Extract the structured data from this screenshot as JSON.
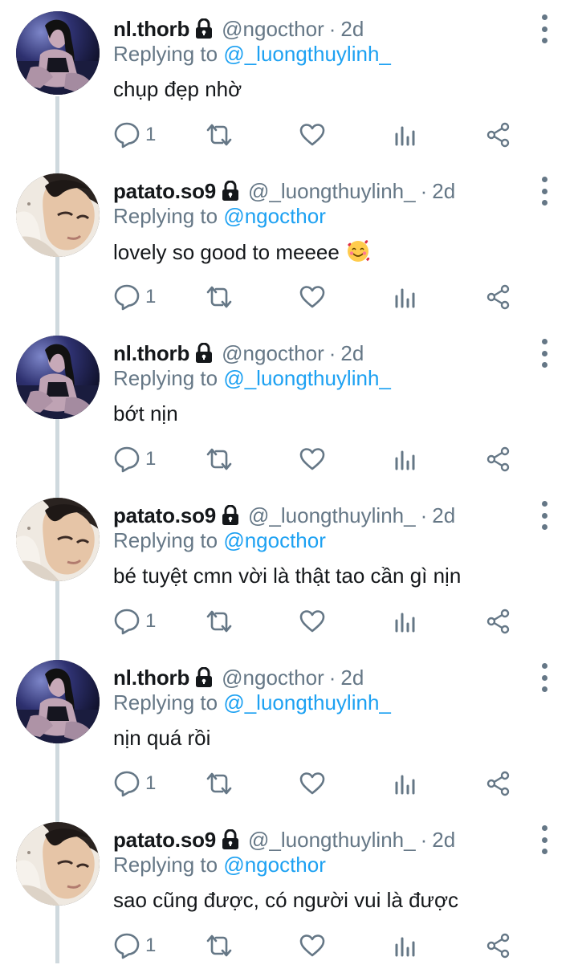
{
  "colors": {
    "text": "#14171a",
    "secondary": "#657786",
    "mention": "#1da1f2",
    "thread_line": "#cfd9de"
  },
  "tweets": [
    {
      "name": "nl.thorb",
      "handle": "@ngocthor",
      "separator": "·",
      "time": "2d",
      "replying_prefix": "Replying to",
      "replying_to": "@_luongthuylinh_",
      "text": "chụp đẹp nhờ",
      "reply_count": "1",
      "avatar": "avatar-ngocthor"
    },
    {
      "name": "patato.so9",
      "handle": "@_luongthuylinh_",
      "separator": "·",
      "time": "2d",
      "replying_prefix": "Replying to",
      "replying_to": "@ngocthor",
      "text": "lovely so good to meeee",
      "emoji": "smiling-face-with-hearts-emoji",
      "reply_count": "1",
      "avatar": "avatar-luongthuylinh"
    },
    {
      "name": "nl.thorb",
      "handle": "@ngocthor",
      "separator": "·",
      "time": "2d",
      "replying_prefix": "Replying to",
      "replying_to": "@_luongthuylinh_",
      "text": "bớt nịn",
      "reply_count": "1",
      "avatar": "avatar-ngocthor"
    },
    {
      "name": "patato.so9",
      "handle": "@_luongthuylinh_",
      "separator": "·",
      "time": "2d",
      "replying_prefix": "Replying to",
      "replying_to": "@ngocthor",
      "text": "bé tuyệt cmn vời là thật tao cần gì nịn",
      "reply_count": "1",
      "avatar": "avatar-luongthuylinh"
    },
    {
      "name": "nl.thorb",
      "handle": "@ngocthor",
      "separator": "·",
      "time": "2d",
      "replying_prefix": "Replying to",
      "replying_to": "@_luongthuylinh_",
      "text": "nịn quá rồi",
      "reply_count": "1",
      "avatar": "avatar-ngocthor"
    },
    {
      "name": "patato.so9",
      "handle": "@_luongthuylinh_",
      "separator": "·",
      "time": "2d",
      "replying_prefix": "Replying to",
      "replying_to": "@ngocthor",
      "text": "sao cũng được, có người vui là được",
      "reply_count": "1",
      "avatar": "avatar-luongthuylinh"
    }
  ],
  "icons": {
    "lock": "lock-icon",
    "more": "more-vertical-icon",
    "reply": "reply-icon",
    "retweet": "retweet-icon",
    "like": "heart-icon",
    "analytics": "analytics-icon",
    "share": "share-icon"
  }
}
